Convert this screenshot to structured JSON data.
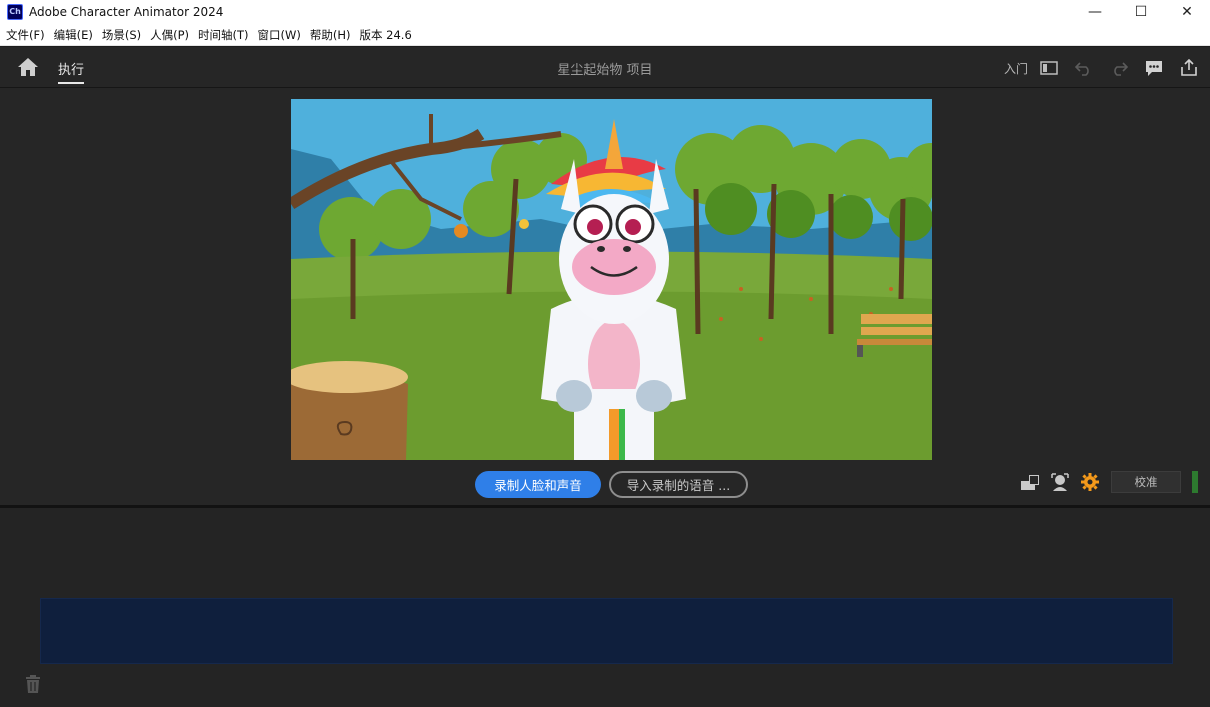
{
  "window": {
    "logo_text": "Ch",
    "title": "Adobe Character Animator 2024",
    "controls": {
      "minimize": "—",
      "maximize": "☐",
      "close": "✕"
    }
  },
  "menu": {
    "items": [
      {
        "label": "文件(F)"
      },
      {
        "label": "编辑(E)"
      },
      {
        "label": "场景(S)"
      },
      {
        "label": "人偶(P)"
      },
      {
        "label": "时间轴(T)"
      },
      {
        "label": "窗口(W)"
      },
      {
        "label": "帮助(H)"
      },
      {
        "label": "版本 24.6"
      }
    ]
  },
  "header": {
    "tab_perform": "执行",
    "project_title": "星尘起始物 项目",
    "learn_label": "入门",
    "icons": [
      "home-icon",
      "panel-toggle-icon",
      "undo-icon",
      "redo-icon",
      "feedback-icon",
      "share-icon"
    ]
  },
  "stage": {
    "record_button": "录制人脸和声音",
    "import_button": "导入录制的语音 ...",
    "calibrate_button": "校准",
    "tool_icons": [
      "camera-input-icon",
      "face-track-icon",
      "settings-gear-icon"
    ],
    "accent_color": "#2f7fe8",
    "gear_color": "#f59a1b"
  },
  "timeline": {
    "track_color": "#0f1f3d"
  }
}
